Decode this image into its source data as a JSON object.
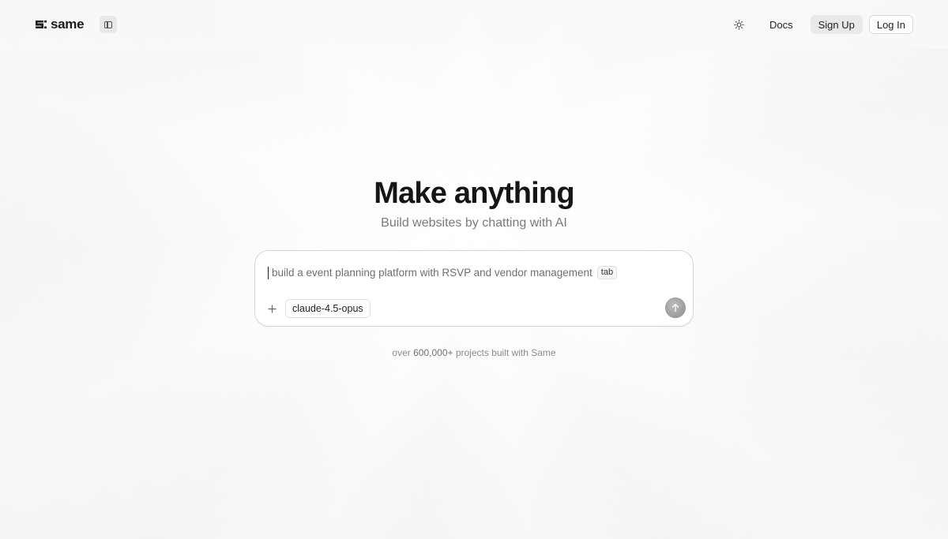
{
  "header": {
    "logo_text": "same",
    "logo_icon": "same-logo-icon",
    "sidebar_toggle_icon": "sidebar-toggle-icon",
    "theme_icon": "sun-icon",
    "nav": {
      "docs_label": "Docs",
      "signup_label": "Sign Up",
      "login_label": "Log In"
    }
  },
  "hero": {
    "title": "Make anything",
    "subtitle": "Build websites by chatting with AI"
  },
  "prompt": {
    "placeholder": "build a event planning platform with RSVP and vendor management",
    "tab_hint": "tab",
    "plus_icon": "plus-icon",
    "model": "claude-4.5-opus",
    "send_icon": "arrow-up-icon"
  },
  "footer": {
    "prefix": "over ",
    "count": "600,000+",
    "suffix": " projects built with Same"
  }
}
